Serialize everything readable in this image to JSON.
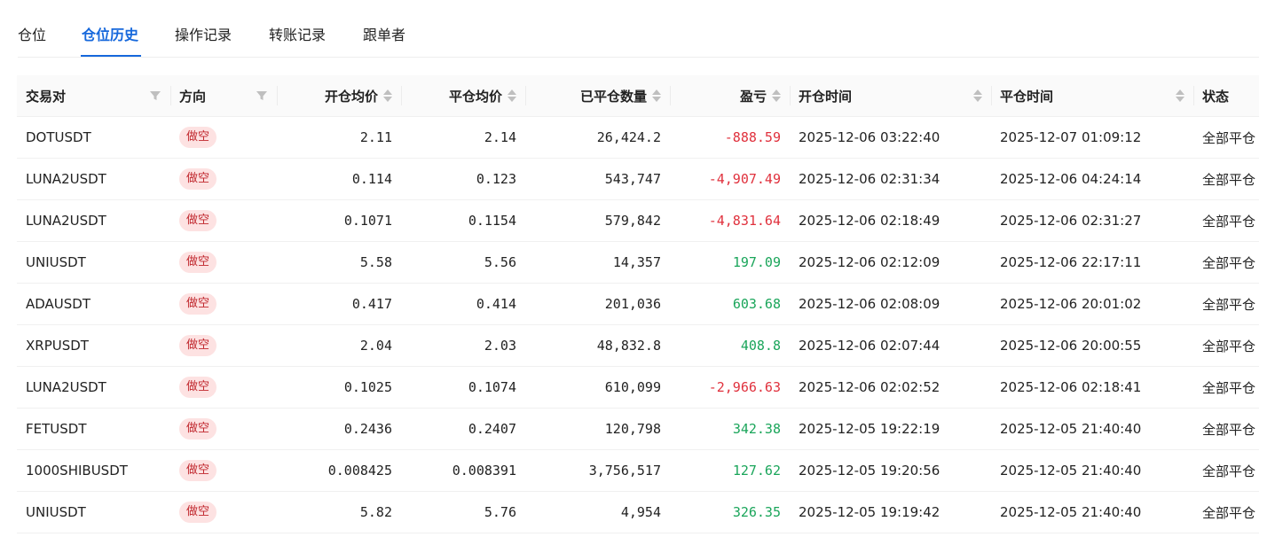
{
  "tabs": [
    {
      "label": "仓位",
      "active": false
    },
    {
      "label": "仓位历史",
      "active": true
    },
    {
      "label": "操作记录",
      "active": false
    },
    {
      "label": "转账记录",
      "active": false
    },
    {
      "label": "跟单者",
      "active": false
    }
  ],
  "table": {
    "headers": {
      "pair": "交易对",
      "side": "方向",
      "open_price": "开仓均价",
      "close_price": "平仓均价",
      "closed_qty": "已平仓数量",
      "pnl": "盈亏",
      "open_time": "开仓时间",
      "close_time": "平仓时间",
      "status": "状态"
    },
    "rows": [
      {
        "pair": "DOTUSDT",
        "side": "做空",
        "open_price": "2.11",
        "close_price": "2.14",
        "closed_qty": "26,424.2",
        "pnl": "-888.59",
        "pnl_sign": "neg",
        "open_time": "2025-12-06 03:22:40",
        "close_time": "2025-12-07 01:09:12",
        "status": "全部平仓"
      },
      {
        "pair": "LUNA2USDT",
        "side": "做空",
        "open_price": "0.114",
        "close_price": "0.123",
        "closed_qty": "543,747",
        "pnl": "-4,907.49",
        "pnl_sign": "neg",
        "open_time": "2025-12-06 02:31:34",
        "close_time": "2025-12-06 04:24:14",
        "status": "全部平仓"
      },
      {
        "pair": "LUNA2USDT",
        "side": "做空",
        "open_price": "0.1071",
        "close_price": "0.1154",
        "closed_qty": "579,842",
        "pnl": "-4,831.64",
        "pnl_sign": "neg",
        "open_time": "2025-12-06 02:18:49",
        "close_time": "2025-12-06 02:31:27",
        "status": "全部平仓"
      },
      {
        "pair": "UNIUSDT",
        "side": "做空",
        "open_price": "5.58",
        "close_price": "5.56",
        "closed_qty": "14,357",
        "pnl": "197.09",
        "pnl_sign": "pos",
        "open_time": "2025-12-06 02:12:09",
        "close_time": "2025-12-06 22:17:11",
        "status": "全部平仓"
      },
      {
        "pair": "ADAUSDT",
        "side": "做空",
        "open_price": "0.417",
        "close_price": "0.414",
        "closed_qty": "201,036",
        "pnl": "603.68",
        "pnl_sign": "pos",
        "open_time": "2025-12-06 02:08:09",
        "close_time": "2025-12-06 20:01:02",
        "status": "全部平仓"
      },
      {
        "pair": "XRPUSDT",
        "side": "做空",
        "open_price": "2.04",
        "close_price": "2.03",
        "closed_qty": "48,832.8",
        "pnl": "408.8",
        "pnl_sign": "pos",
        "open_time": "2025-12-06 02:07:44",
        "close_time": "2025-12-06 20:00:55",
        "status": "全部平仓"
      },
      {
        "pair": "LUNA2USDT",
        "side": "做空",
        "open_price": "0.1025",
        "close_price": "0.1074",
        "closed_qty": "610,099",
        "pnl": "-2,966.63",
        "pnl_sign": "neg",
        "open_time": "2025-12-06 02:02:52",
        "close_time": "2025-12-06 02:18:41",
        "status": "全部平仓"
      },
      {
        "pair": "FETUSDT",
        "side": "做空",
        "open_price": "0.2436",
        "close_price": "0.2407",
        "closed_qty": "120,798",
        "pnl": "342.38",
        "pnl_sign": "pos",
        "open_time": "2025-12-05 19:22:19",
        "close_time": "2025-12-05 21:40:40",
        "status": "全部平仓"
      },
      {
        "pair": "1000SHIBUSDT",
        "side": "做空",
        "open_price": "0.008425",
        "close_price": "0.008391",
        "closed_qty": "3,756,517",
        "pnl": "127.62",
        "pnl_sign": "pos",
        "open_time": "2025-12-05 19:20:56",
        "close_time": "2025-12-05 21:40:40",
        "status": "全部平仓"
      },
      {
        "pair": "UNIUSDT",
        "side": "做空",
        "open_price": "5.82",
        "close_price": "5.76",
        "closed_qty": "4,954",
        "pnl": "326.35",
        "pnl_sign": "pos",
        "open_time": "2025-12-05 19:19:42",
        "close_time": "2025-12-05 21:40:40",
        "status": "全部平仓"
      }
    ]
  },
  "colors": {
    "accent": "#1668dc",
    "loss": "#e0313d",
    "profit": "#1aa55a",
    "short_badge_bg": "#fde2e2",
    "short_badge_text": "#c0272d"
  }
}
